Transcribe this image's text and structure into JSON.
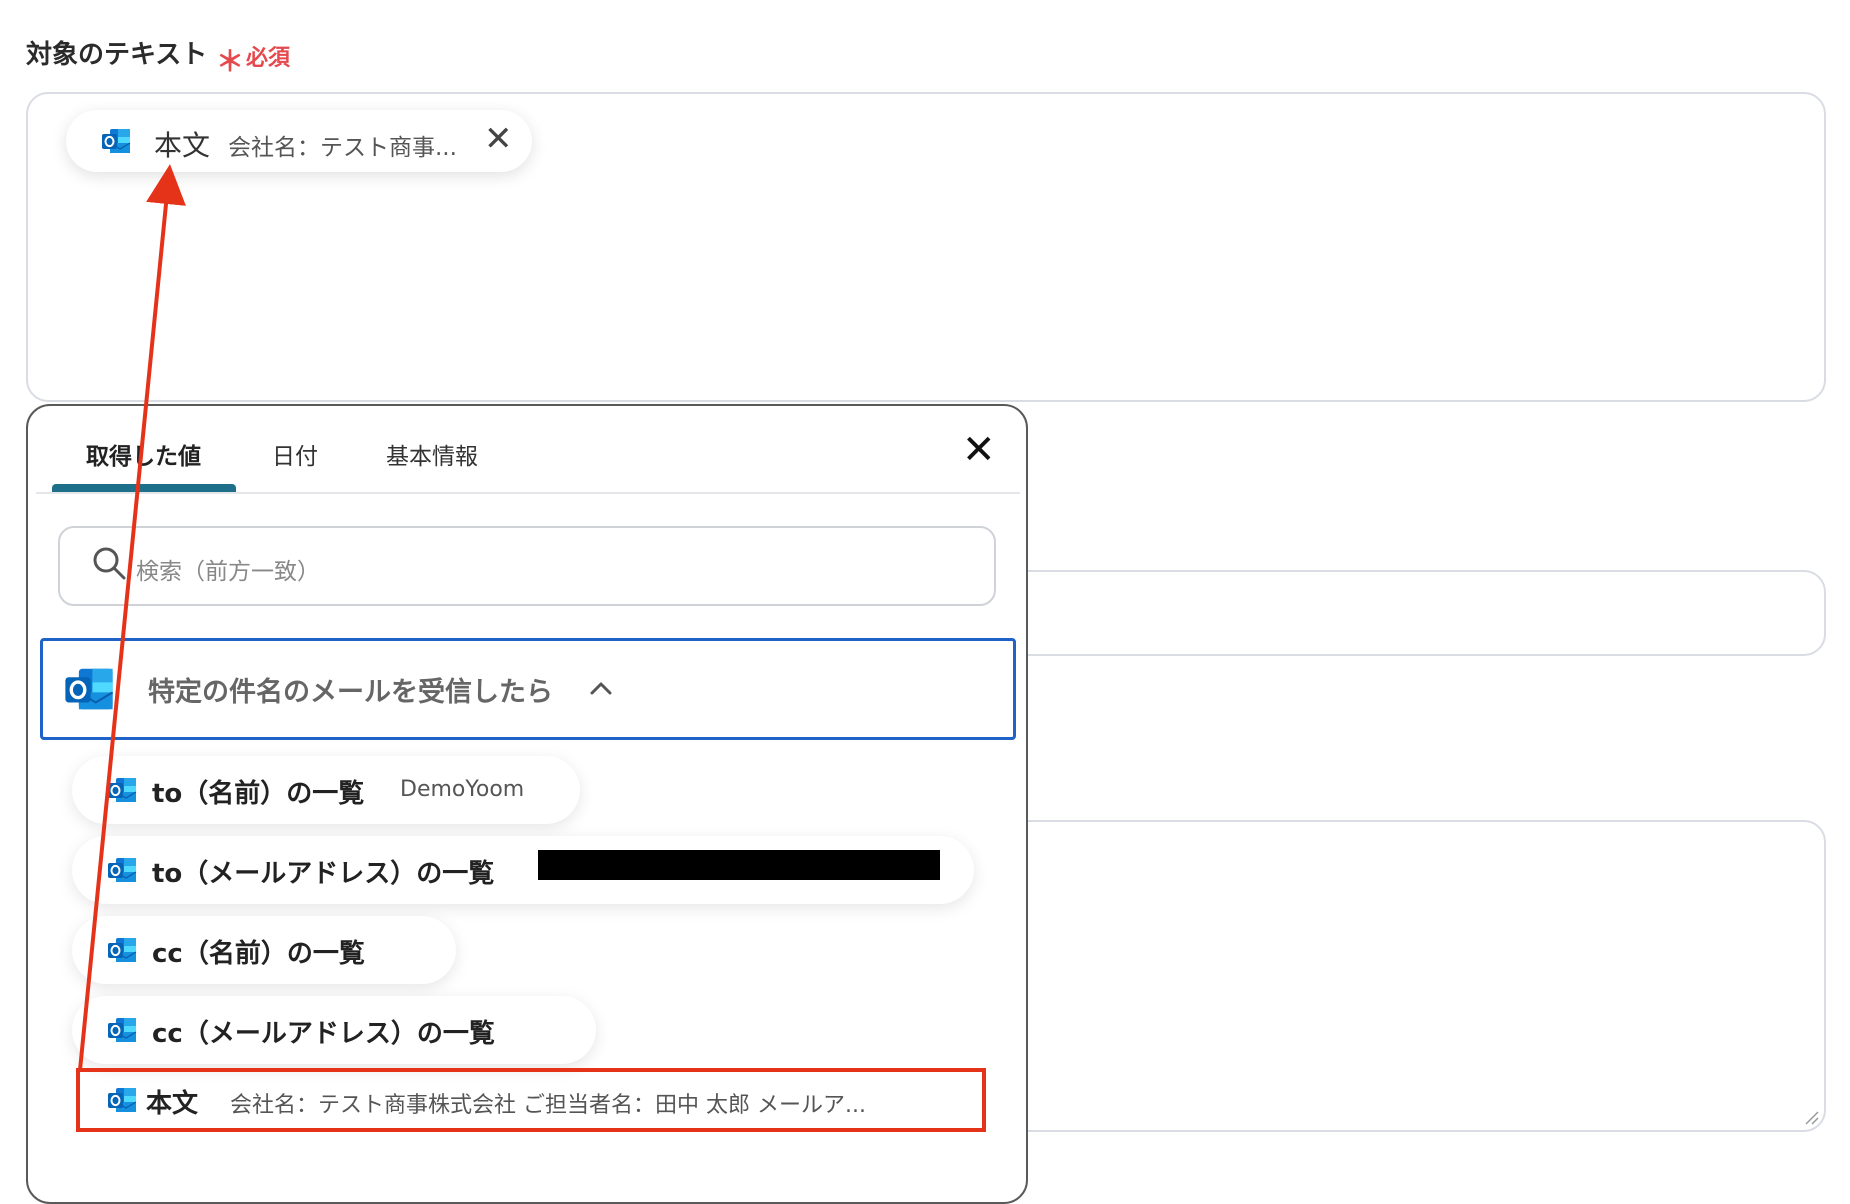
{
  "field": {
    "label": "対象のテキスト",
    "required_star": "＊",
    "required_text": "必須"
  },
  "selected_chip": {
    "icon": "outlook-icon",
    "label": "本文",
    "value": "会社名：テスト商事...",
    "remove_icon": "close-icon"
  },
  "picker": {
    "tabs": [
      {
        "label": "取得した値",
        "active": true
      },
      {
        "label": "日付",
        "active": false
      },
      {
        "label": "基本情報",
        "active": false
      }
    ],
    "close_icon": "close-icon",
    "search": {
      "placeholder": "検索（前方一致）",
      "icon": "search-icon"
    },
    "trigger": {
      "label": "特定の件名のメールを受信したら",
      "icon": "outlook-icon",
      "chevron": "chevron-up-icon"
    },
    "items": [
      {
        "label": "to（名前）の一覧",
        "value": "DemoYoom"
      },
      {
        "label": "to（メールアドレス）の一覧",
        "value": ""
      },
      {
        "label": "cc（名前）の一覧",
        "value": ""
      },
      {
        "label": "cc（メールアドレス）の一覧",
        "value": ""
      },
      {
        "label": "本文",
        "value": "会社名：テスト商事株式会社 ご担当者名：田中 太郎 メールア..."
      }
    ]
  },
  "colors": {
    "required": "#e5484d",
    "tab_active_underline": "#1d6f8a",
    "trigger_border": "#1f63c9",
    "annotation": "#e5331a"
  }
}
